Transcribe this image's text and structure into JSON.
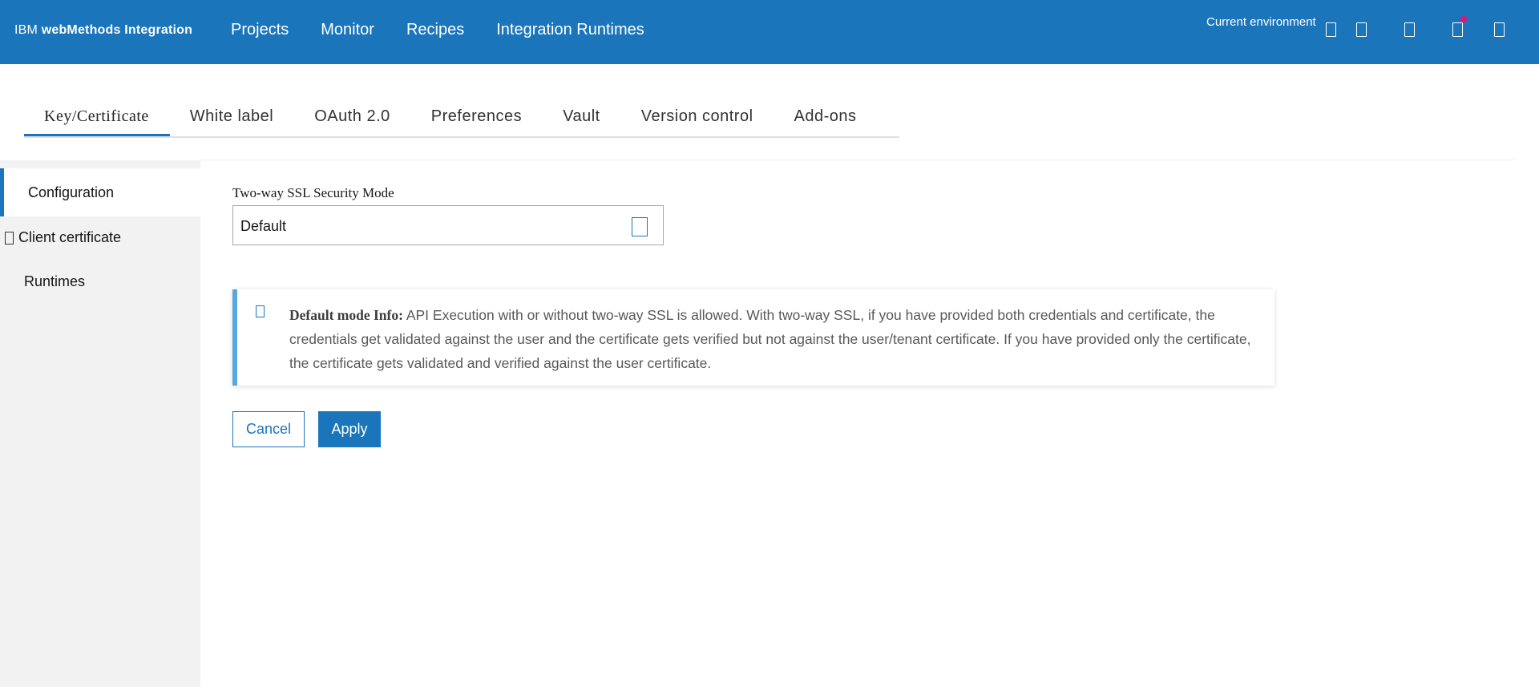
{
  "header": {
    "brand_prefix": "IBM",
    "brand_name": "webMethods Integration",
    "nav": [
      "Projects",
      "Monitor",
      "Recipes",
      "Integration Runtimes"
    ],
    "env_label": "Current environment",
    "icons": [
      "environment-icon",
      "help-icon",
      "apps-icon",
      "notifications-icon",
      "user-icon"
    ],
    "accent_color": "#1b75bb",
    "notification_dot_color": "#e0157a"
  },
  "tabs": [
    "Key/Certificate",
    "White label",
    "OAuth 2.0",
    "Preferences",
    "Vault",
    "Version control",
    "Add-ons"
  ],
  "active_tab": "Key/Certificate",
  "sidebar": {
    "items": [
      {
        "label": "Configuration",
        "active": true
      },
      {
        "label": "Client certificate",
        "active": false
      },
      {
        "label": "Runtimes",
        "active": false
      }
    ]
  },
  "form": {
    "mode_label": "Two-way SSL Security Mode",
    "mode_value": "Default"
  },
  "info": {
    "title": "Default mode Info:",
    "text": " API Execution with or without two-way SSL is allowed. With two-way SSL, if you have provided both credentials and certificate, the credentials get validated against the user and the certificate gets verified but not against the user/tenant certificate. If you have provided only the certificate, the certificate gets validated and verified against the user certificate."
  },
  "buttons": {
    "cancel": "Cancel",
    "apply": "Apply"
  }
}
